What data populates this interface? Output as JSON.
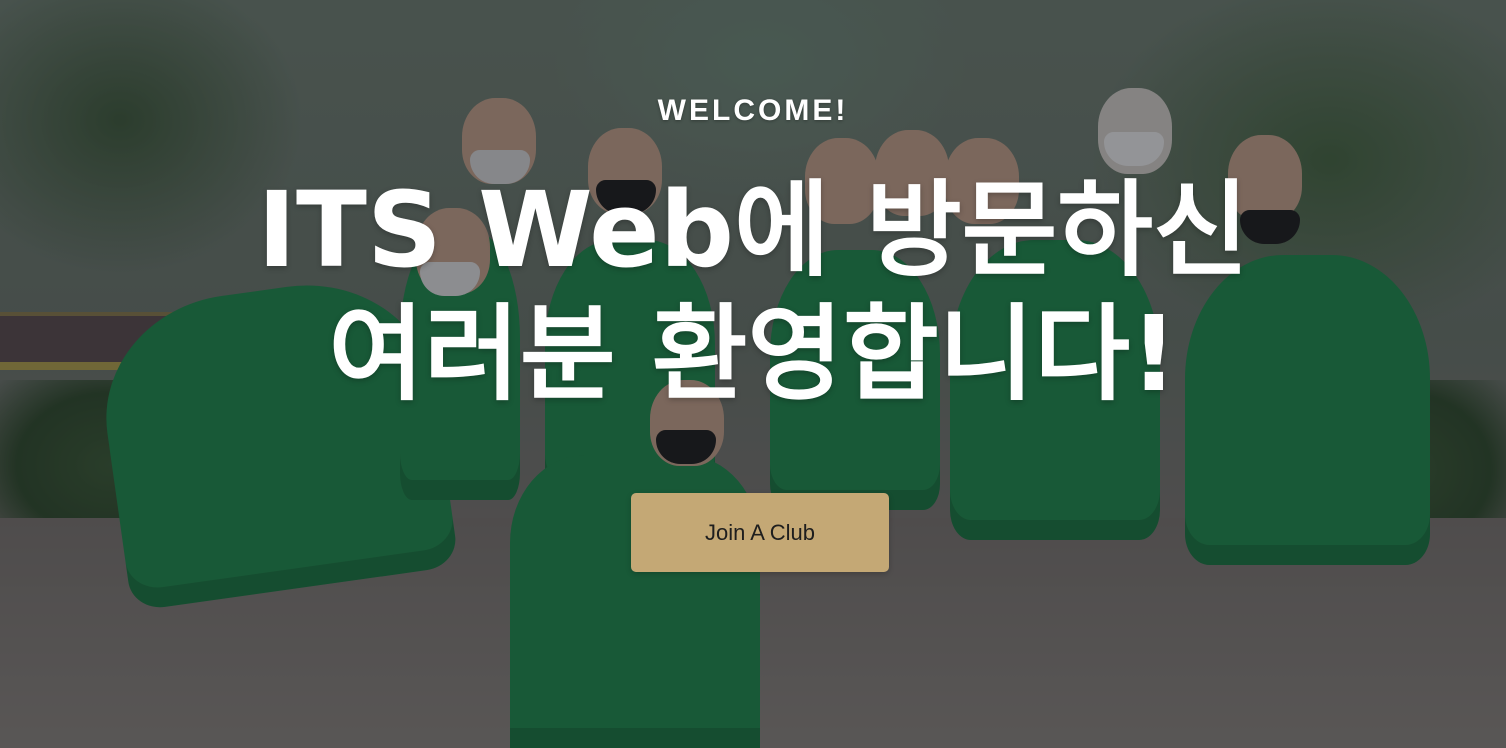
{
  "hero": {
    "eyebrow": "WELCOME!",
    "title_line1": "ITS Web에 방문하신",
    "title_line2": "여러분 환영합니다!",
    "cta_label": "Join A Club"
  },
  "colors": {
    "cta_background": "#c4a875",
    "cta_text": "#1e1e1e",
    "text_primary": "#ffffff",
    "overlay": "#14161c"
  }
}
